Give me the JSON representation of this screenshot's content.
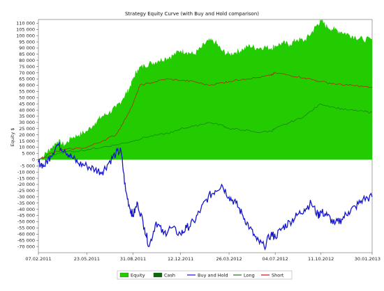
{
  "chart_data": {
    "type": "area",
    "title": "Strategy Equity Curve (with Buy and Hold comparison)",
    "ylabel": "Equity $",
    "xlabel": "",
    "ylim": [
      -75000,
      113000
    ],
    "yticks": [
      110000,
      105000,
      100000,
      95000,
      90000,
      85000,
      80000,
      75000,
      70000,
      65000,
      60000,
      55000,
      50000,
      45000,
      40000,
      35000,
      30000,
      25000,
      20000,
      15000,
      10000,
      5000,
      0,
      -5000,
      -10000,
      -15000,
      -20000,
      -25000,
      -30000,
      -35000,
      -40000,
      -45000,
      -50000,
      -55000,
      -60000,
      -65000,
      -70000
    ],
    "ytick_labels": [
      "110 000",
      "105 000",
      "100 000",
      "95 000",
      "90 000",
      "85 000",
      "80 000",
      "75 000",
      "70 000",
      "65 000",
      "60 000",
      "55 000",
      "50 000",
      "45 000",
      "40 000",
      "35 000",
      "30 000",
      "25 000",
      "20 000",
      "15 000",
      "10 000",
      "5 000",
      "0",
      "-5 000",
      "-10 000",
      "-15 000",
      "-20 000",
      "-25 000",
      "-30 000",
      "-35 000",
      "-40 000",
      "-45 000",
      "-50 000",
      "-55 000",
      "-60 000",
      "-65 000",
      "-70 000"
    ],
    "x_range": [
      "2011-02-07",
      "2013-01-30"
    ],
    "xticks": [
      "2011-02-07",
      "2011-05-23",
      "2011-08-31",
      "2011-12-12",
      "2012-03-26",
      "2012-07-04",
      "2012-10-11",
      "2013-01-30"
    ],
    "xtick_labels": [
      "07.02.2011",
      "23.05.2011",
      "31.08.2011",
      "12.12.2011",
      "26.03.2012",
      "04.07.2012",
      "11.10.2012",
      "30.01.2013"
    ],
    "grid": false,
    "legend_position": "bottom",
    "series": [
      {
        "name": "Equity",
        "kind": "area",
        "color": "#22cc00",
        "points": [
          [
            "2011-02-07",
            0
          ],
          [
            "2011-02-20",
            4000
          ],
          [
            "2011-03-05",
            9000
          ],
          [
            "2011-03-20",
            15000
          ],
          [
            "2011-04-05",
            12000
          ],
          [
            "2011-04-20",
            18000
          ],
          [
            "2011-05-05",
            20000
          ],
          [
            "2011-05-23",
            23000
          ],
          [
            "2011-06-10",
            30000
          ],
          [
            "2011-06-25",
            35000
          ],
          [
            "2011-07-10",
            38000
          ],
          [
            "2011-07-25",
            42000
          ],
          [
            "2011-08-10",
            50000
          ],
          [
            "2011-08-22",
            57000
          ],
          [
            "2011-08-31",
            65000
          ],
          [
            "2011-09-10",
            73000
          ],
          [
            "2011-09-25",
            76000
          ],
          [
            "2011-10-10",
            78000
          ],
          [
            "2011-10-25",
            80000
          ],
          [
            "2011-11-10",
            82000
          ],
          [
            "2011-11-25",
            84000
          ],
          [
            "2011-12-12",
            88000
          ],
          [
            "2011-12-25",
            87000
          ],
          [
            "2012-01-10",
            85000
          ],
          [
            "2012-01-25",
            90000
          ],
          [
            "2012-02-10",
            96000
          ],
          [
            "2012-02-25",
            95000
          ],
          [
            "2012-03-10",
            88000
          ],
          [
            "2012-03-26",
            85000
          ],
          [
            "2012-04-10",
            87000
          ],
          [
            "2012-04-25",
            89000
          ],
          [
            "2012-05-10",
            92000
          ],
          [
            "2012-05-25",
            90000
          ],
          [
            "2012-06-10",
            91000
          ],
          [
            "2012-06-25",
            90000
          ],
          [
            "2012-07-04",
            92000
          ],
          [
            "2012-07-20",
            94000
          ],
          [
            "2012-08-05",
            93000
          ],
          [
            "2012-08-20",
            97000
          ],
          [
            "2012-09-05",
            96000
          ],
          [
            "2012-09-20",
            102000
          ],
          [
            "2012-10-01",
            108000
          ],
          [
            "2012-10-11",
            112000
          ],
          [
            "2012-10-25",
            107000
          ],
          [
            "2012-11-10",
            105000
          ],
          [
            "2012-11-25",
            103000
          ],
          [
            "2012-12-10",
            101000
          ],
          [
            "2012-12-25",
            99000
          ],
          [
            "2013-01-10",
            97000
          ],
          [
            "2013-01-30",
            97000
          ]
        ]
      },
      {
        "name": "Cash",
        "kind": "area",
        "color": "#0a6a0a",
        "points": [
          [
            "2011-02-07",
            0
          ],
          [
            "2013-01-30",
            0
          ]
        ]
      },
      {
        "name": "Buy and Hold",
        "kind": "line",
        "color": "#1515d0",
        "points": [
          [
            "2011-02-07",
            -2000
          ],
          [
            "2011-02-20",
            -5000
          ],
          [
            "2011-03-05",
            3000
          ],
          [
            "2011-03-20",
            12000
          ],
          [
            "2011-04-05",
            8000
          ],
          [
            "2011-04-20",
            2000
          ],
          [
            "2011-05-05",
            -3000
          ],
          [
            "2011-05-23",
            -5000
          ],
          [
            "2011-06-10",
            -8000
          ],
          [
            "2011-06-25",
            -10000
          ],
          [
            "2011-07-10",
            -2000
          ],
          [
            "2011-07-25",
            5000
          ],
          [
            "2011-08-05",
            7000
          ],
          [
            "2011-08-15",
            -25000
          ],
          [
            "2011-08-25",
            -40000
          ],
          [
            "2011-08-31",
            -45000
          ],
          [
            "2011-09-10",
            -35000
          ],
          [
            "2011-09-25",
            -55000
          ],
          [
            "2011-10-05",
            -70000
          ],
          [
            "2011-10-20",
            -50000
          ],
          [
            "2011-11-05",
            -60000
          ],
          [
            "2011-11-20",
            -55000
          ],
          [
            "2011-12-12",
            -60000
          ],
          [
            "2011-12-25",
            -55000
          ],
          [
            "2012-01-10",
            -50000
          ],
          [
            "2012-01-25",
            -40000
          ],
          [
            "2012-02-10",
            -30000
          ],
          [
            "2012-02-25",
            -25000
          ],
          [
            "2012-03-10",
            -20000
          ],
          [
            "2012-03-26",
            -30000
          ],
          [
            "2012-04-10",
            -35000
          ],
          [
            "2012-04-25",
            -45000
          ],
          [
            "2012-05-10",
            -55000
          ],
          [
            "2012-05-25",
            -65000
          ],
          [
            "2012-06-10",
            -70000
          ],
          [
            "2012-06-25",
            -60000
          ],
          [
            "2012-07-04",
            -62000
          ],
          [
            "2012-07-20",
            -55000
          ],
          [
            "2012-08-05",
            -50000
          ],
          [
            "2012-08-20",
            -45000
          ],
          [
            "2012-09-05",
            -40000
          ],
          [
            "2012-09-20",
            -35000
          ],
          [
            "2012-10-05",
            -45000
          ],
          [
            "2012-10-11",
            -42000
          ],
          [
            "2012-10-25",
            -45000
          ],
          [
            "2012-11-10",
            -52000
          ],
          [
            "2012-11-25",
            -48000
          ],
          [
            "2012-12-10",
            -42000
          ],
          [
            "2012-12-25",
            -38000
          ],
          [
            "2013-01-10",
            -32000
          ],
          [
            "2013-01-30",
            -30000
          ]
        ]
      },
      {
        "name": "Long",
        "kind": "line",
        "color": "#1a7a1a",
        "points": [
          [
            "2011-02-07",
            0
          ],
          [
            "2011-03-05",
            3000
          ],
          [
            "2011-04-05",
            6000
          ],
          [
            "2011-05-23",
            8000
          ],
          [
            "2011-06-25",
            10000
          ],
          [
            "2011-07-25",
            12000
          ],
          [
            "2011-08-31",
            15000
          ],
          [
            "2011-09-25",
            18000
          ],
          [
            "2011-10-25",
            20000
          ],
          [
            "2011-11-25",
            22000
          ],
          [
            "2011-12-12",
            25000
          ],
          [
            "2012-01-10",
            27000
          ],
          [
            "2012-02-10",
            30000
          ],
          [
            "2012-03-10",
            28000
          ],
          [
            "2012-03-26",
            25000
          ],
          [
            "2012-04-25",
            24000
          ],
          [
            "2012-05-25",
            22000
          ],
          [
            "2012-06-25",
            23000
          ],
          [
            "2012-07-04",
            25000
          ],
          [
            "2012-08-05",
            30000
          ],
          [
            "2012-09-05",
            35000
          ],
          [
            "2012-10-11",
            45000
          ],
          [
            "2012-11-10",
            42000
          ],
          [
            "2012-12-10",
            40000
          ],
          [
            "2013-01-10",
            39000
          ],
          [
            "2013-01-30",
            38000
          ]
        ]
      },
      {
        "name": "Short",
        "kind": "line",
        "color": "#cc1010",
        "points": [
          [
            "2011-02-07",
            0
          ],
          [
            "2011-03-05",
            5000
          ],
          [
            "2011-04-05",
            8000
          ],
          [
            "2011-05-23",
            10000
          ],
          [
            "2011-06-25",
            15000
          ],
          [
            "2011-07-25",
            20000
          ],
          [
            "2011-08-10",
            30000
          ],
          [
            "2011-08-31",
            45000
          ],
          [
            "2011-09-15",
            60000
          ],
          [
            "2011-10-10",
            62000
          ],
          [
            "2011-11-10",
            65000
          ],
          [
            "2011-12-12",
            64000
          ],
          [
            "2012-01-10",
            63000
          ],
          [
            "2012-02-10",
            60000
          ],
          [
            "2012-03-10",
            62000
          ],
          [
            "2012-03-26",
            63000
          ],
          [
            "2012-04-25",
            65000
          ],
          [
            "2012-05-25",
            66000
          ],
          [
            "2012-06-25",
            68000
          ],
          [
            "2012-07-04",
            70000
          ],
          [
            "2012-08-05",
            68000
          ],
          [
            "2012-09-05",
            66000
          ],
          [
            "2012-10-11",
            63000
          ],
          [
            "2012-11-10",
            61000
          ],
          [
            "2012-12-10",
            60000
          ],
          [
            "2013-01-10",
            59000
          ],
          [
            "2013-01-30",
            58000
          ]
        ]
      }
    ]
  }
}
